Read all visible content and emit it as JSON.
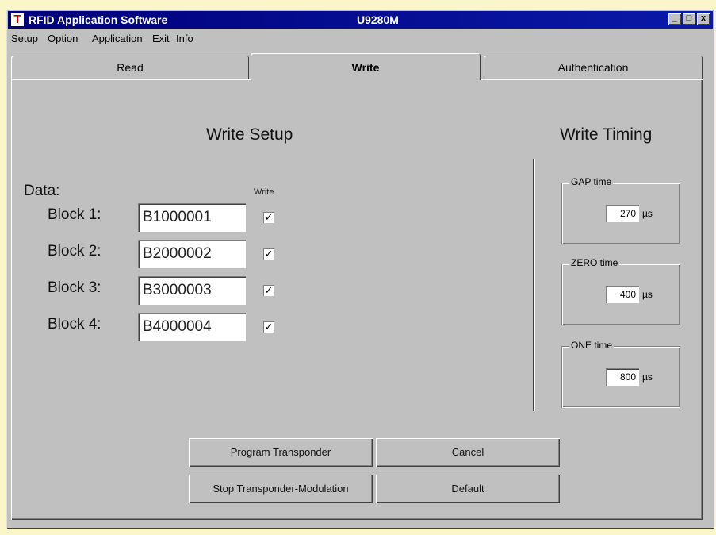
{
  "window": {
    "title": "RFID Application Software",
    "model": "U9280M",
    "controls": {
      "minimize": "_",
      "maximize": "□",
      "close": "x"
    },
    "logo_letter": "T"
  },
  "menu": [
    "Setup",
    "Option",
    "Application",
    "Exit",
    "Info"
  ],
  "tabs": [
    {
      "label": "Read",
      "active": false
    },
    {
      "label": "Write",
      "active": true
    },
    {
      "label": "Authentication",
      "active": false
    }
  ],
  "write_setup": {
    "heading": "Write Setup",
    "data_label": "Data:",
    "write_column_label": "Write",
    "blocks": [
      {
        "label": "Block 1:",
        "value": "B1000001",
        "write": true
      },
      {
        "label": "Block 2:",
        "value": "B2000002",
        "write": true
      },
      {
        "label": "Block 3:",
        "value": "B3000003",
        "write": true
      },
      {
        "label": "Block 4:",
        "value": "B4000004",
        "write": true
      }
    ]
  },
  "write_timing": {
    "heading": "Write Timing",
    "groups": [
      {
        "label": "GAP time",
        "value": "270",
        "unit": "µs"
      },
      {
        "label": "ZERO time",
        "value": "400",
        "unit": "µs"
      },
      {
        "label": "ONE time",
        "value": "800",
        "unit": "µs"
      }
    ]
  },
  "buttons": {
    "program": "Program Transponder",
    "cancel": "Cancel",
    "stop": "Stop Transponder-Modulation",
    "default": "Default"
  },
  "check_glyph": "✓"
}
